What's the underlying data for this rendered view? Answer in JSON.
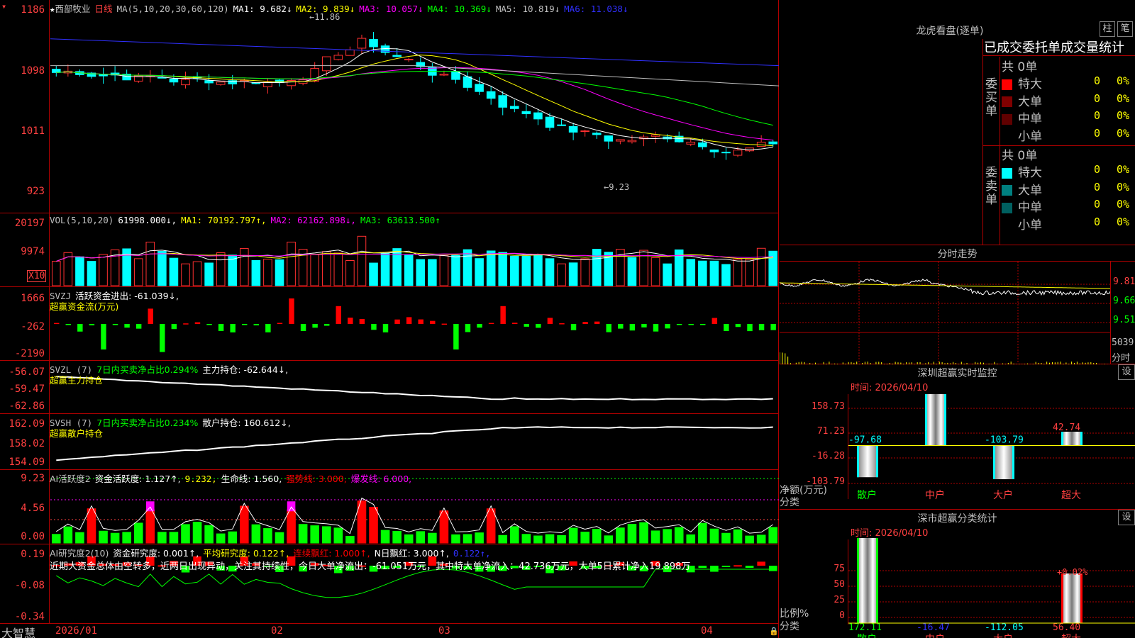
{
  "stock": {
    "star": "★",
    "name": "西部牧业",
    "period": "日线",
    "ma_def": "MA(5,10,20,30,60,120)",
    "ma_values": [
      {
        "label": "MA1: 9.682↓",
        "color": "#ffffff"
      },
      {
        "label": "MA2: 9.839↓",
        "color": "#ffff00"
      },
      {
        "label": "MA3: 10.057↓",
        "color": "#ff00ff"
      },
      {
        "label": "MA4: 10.369↓",
        "color": "#00ff00"
      },
      {
        "label": "MA5: 10.819↓",
        "color": "#c0c0c0"
      },
      {
        "label": "MA6: 11.038↓",
        "color": "#3030ff"
      }
    ],
    "price_axis": [
      "1186",
      "1098",
      "1011",
      "923"
    ],
    "high_label": "11.86",
    "low_label": "9.23"
  },
  "vol": {
    "header": "VOL(5,10,20)",
    "value": "61998.000↓,",
    "ma1": "MA1: 70192.797↑,",
    "ma2": "MA2: 62162.898↓,",
    "ma3": "MA3: 63613.500↑",
    "axis": [
      "20197",
      "9974"
    ],
    "unit": "X10"
  },
  "svzj": {
    "header": "SVZJ",
    "name": "活跃资金进出: -61.039↓,",
    "sub": "超赢资金流(万元)",
    "axis": [
      "1666",
      "-262",
      "-2190"
    ]
  },
  "svzl": {
    "header": "SVZL (7)",
    "green": "7日内买卖净占比0.294%",
    "white": "主力持仓: -62.644↓,",
    "sub": "超赢主力持仓",
    "axis": [
      "-56.07",
      "-59.47",
      "-62.86"
    ]
  },
  "svsh": {
    "header": "SVSH (7)",
    "green": "7日内买卖净占比0.234%",
    "white": "散户持仓: 160.612↓,",
    "sub": "超赢散户持仓",
    "axis": [
      "162.09",
      "158.02",
      "154.09"
    ]
  },
  "ai1": {
    "header": "AI活跃度2",
    "v1": "资金活跃度: 1.127↑,",
    "v2": "9.232,",
    "v3": "生命线: 1.560,",
    "v4": "强势线: 3.000,",
    "v5": "爆发线: 6.000,",
    "axis": [
      "9.23",
      "4.56",
      "0.00"
    ]
  },
  "ai2": {
    "header": "AI研究度2(10)",
    "v1": "资金研究度: 0.001↑,",
    "v2": "平均研究度: 0.122↑,",
    "v3": "连续飘红: 1.000↑,",
    "v4": "N日飘红: 3.000↑,",
    "v5": "0.122↑,",
    "note": "近期大资金总体由空转多，近两日出现异动，关注其持续性，今日大单净流出：-61.051万元，其中特大单净流入：42.736万元，大单5日累计净入19.898万",
    "axis": [
      "0.19",
      "-0.08",
      "-0.34"
    ]
  },
  "xaxis": [
    "2026/01",
    "02",
    "03",
    "04"
  ],
  "brand": "大智慧",
  "longhu": {
    "title": "龙虎看盘(逐单)",
    "btn1": "柱",
    "btn2": "笔",
    "subtitle": "已成交委托单成交量统计",
    "buy_label": "委买单",
    "sell_label": "委卖单",
    "buy_total": "共 0单",
    "sell_total": "共 0单",
    "buy_rows": [
      {
        "name": "特大",
        "count": "0",
        "pct": "0%",
        "color": "#ff0000"
      },
      {
        "name": "大单",
        "count": "0",
        "pct": "0%",
        "color": "#800000"
      },
      {
        "name": "中单",
        "count": "0",
        "pct": "0%",
        "color": "#600000"
      },
      {
        "name": "小单",
        "count": "0",
        "pct": "0%",
        "color": "#000000"
      }
    ],
    "sell_rows": [
      {
        "name": "特大",
        "count": "0",
        "pct": "0%",
        "color": "#00ffff"
      },
      {
        "name": "大单",
        "count": "0",
        "pct": "0%",
        "color": "#008080"
      },
      {
        "name": "中单",
        "count": "0",
        "pct": "0%",
        "color": "#006060"
      },
      {
        "name": "小单",
        "count": "0",
        "pct": "0%",
        "color": "#000000"
      }
    ]
  },
  "intraday": {
    "title": "分时走势",
    "axis": [
      "9.81",
      "9.66",
      "9.51"
    ],
    "vol_label": "5039",
    "vol_unit": "分时"
  },
  "sz_monitor": {
    "title": "深圳超赢实时监控",
    "set": "设",
    "time": "时间: 2026/04/10",
    "axis": [
      "158.73",
      "71.23",
      "-16.28",
      "-103.79"
    ],
    "left_label": "净额(万元)",
    "left_label2": "分类",
    "categories": [
      "散户",
      "中户",
      "大户",
      "超大"
    ],
    "values": [
      -97.68,
      158.73,
      -103.79,
      42.74
    ],
    "value_labels": [
      "-97.68",
      "158.73",
      "-103.79",
      "42.74"
    ]
  },
  "sz_class": {
    "title": "深市超赢分类统计",
    "set": "设",
    "time": "时间: 2026/04/10",
    "axis": [
      "75",
      "50",
      "25",
      "0"
    ],
    "left_label": "比例%",
    "left_label2": "分类",
    "categories": [
      "散户",
      "中户",
      "大户",
      "超大"
    ],
    "values": [
      172.11,
      -16.47,
      -112.05,
      56.4
    ],
    "value_labels": [
      "172.11",
      "-16.47",
      "-112.05",
      "56.40"
    ],
    "extra_label": "+0.02%"
  }
}
